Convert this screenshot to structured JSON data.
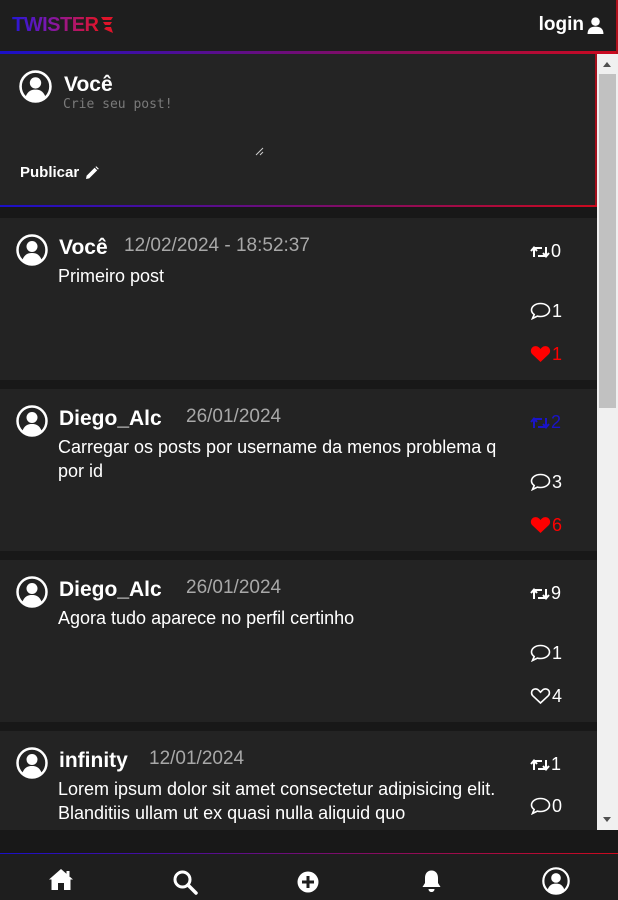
{
  "header": {
    "logo_text": "TWISTER",
    "login_label": "login"
  },
  "composer": {
    "name": "Você",
    "placeholder": "Crie seu post!",
    "publish_label": "Publicar"
  },
  "posts": [
    {
      "author": "Você",
      "date": "12/02/2024 - 18:52:37",
      "text": "Primeiro post",
      "retweets": "0",
      "comments": "1",
      "likes": "1",
      "liked": true,
      "retweeted": false
    },
    {
      "author": "Diego_Alc",
      "date": "26/01/2024",
      "text": "Carregar os posts por username da menos problema q por id",
      "retweets": "2",
      "comments": "3",
      "likes": "6",
      "liked": true,
      "retweeted": true
    },
    {
      "author": "Diego_Alc",
      "date": "26/01/2024",
      "text": "Agora tudo aparece no perfil certinho",
      "retweets": "9",
      "comments": "1",
      "likes": "4",
      "liked": false,
      "retweeted": false
    },
    {
      "author": "infinity",
      "date": "12/01/2024",
      "text": "Lorem ipsum dolor sit amet consectetur adipisicing elit. Blanditiis ullam ut ex quasi nulla aliquid quo",
      "retweets": "1",
      "comments": "0",
      "likes": "",
      "liked": false,
      "retweeted": false
    }
  ],
  "nav": {
    "items": [
      "home-icon",
      "search-icon",
      "plus-circle-icon",
      "bell-icon",
      "user-circle-icon"
    ]
  },
  "colors": {
    "accent_blue": "#1a10c8",
    "accent_red": "#cc0a1e",
    "like_red": "#ff0000",
    "retweet_blue": "#1a14c8",
    "background": "#181818",
    "card": "#232323"
  }
}
